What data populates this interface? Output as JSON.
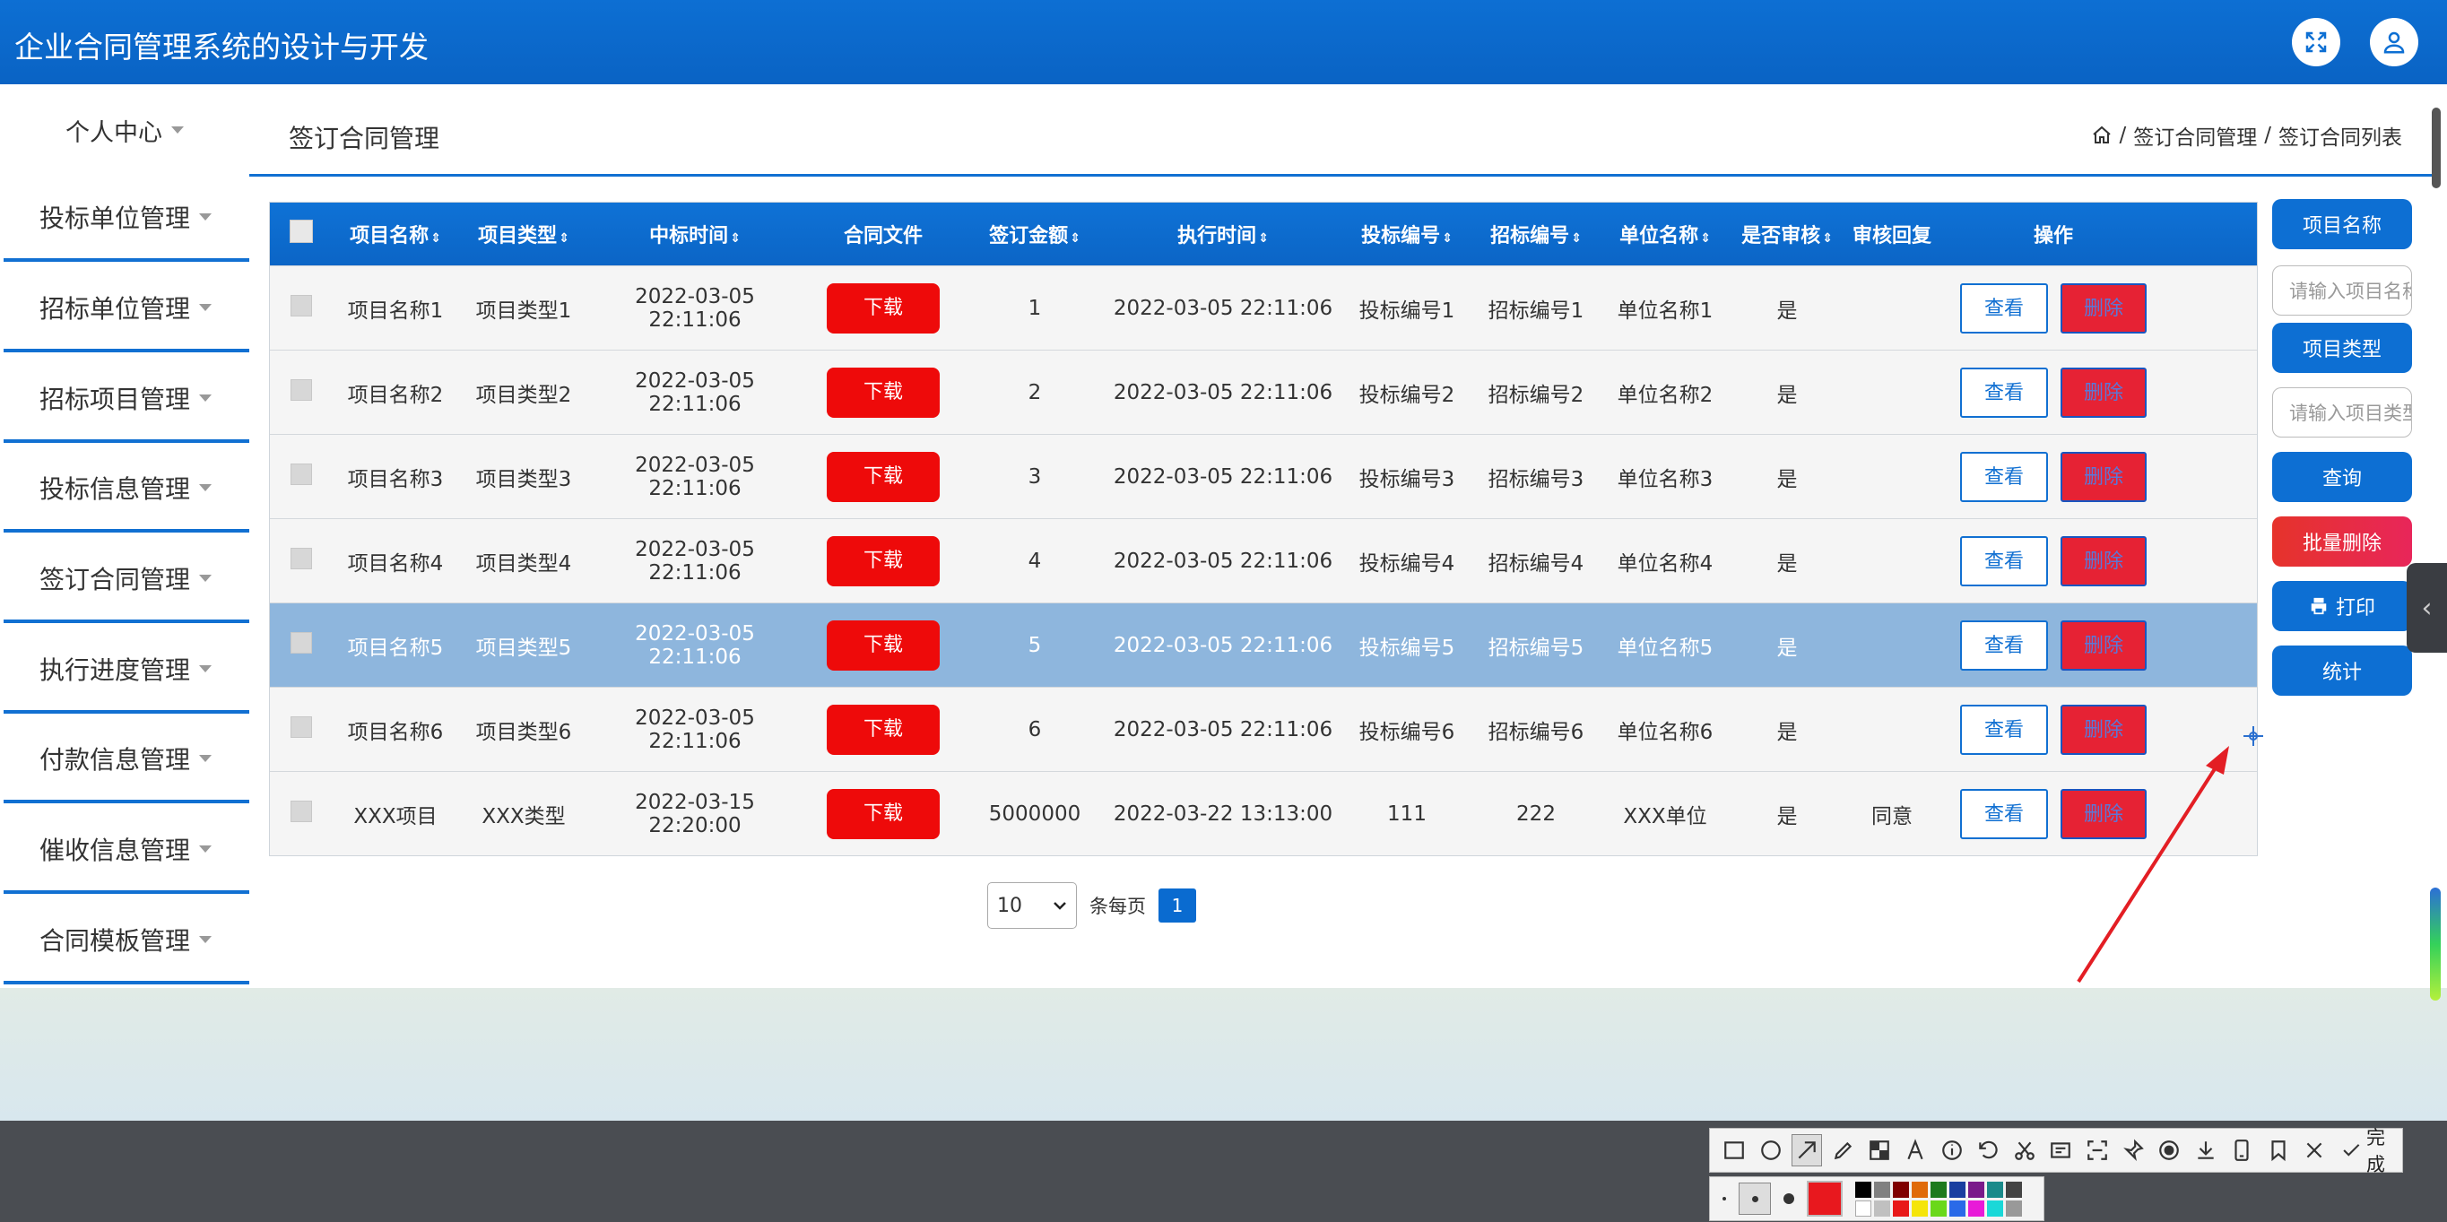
{
  "app": {
    "title": "企业合同管理系统的设计与开发"
  },
  "header": {
    "fullscreen_icon": "expand-icon",
    "user_icon": "user-icon"
  },
  "sidebar": {
    "personal": "个人中心",
    "items": [
      {
        "label": "投标单位管理"
      },
      {
        "label": "招标单位管理"
      },
      {
        "label": "招标项目管理"
      },
      {
        "label": "投标信息管理"
      },
      {
        "label": "签订合同管理"
      },
      {
        "label": "执行进度管理"
      },
      {
        "label": "付款信息管理"
      },
      {
        "label": "催收信息管理"
      },
      {
        "label": "合同模板管理"
      }
    ]
  },
  "page": {
    "title": "签订合同管理",
    "breadcrumb": {
      "sep": "/",
      "level1": "签订合同管理",
      "level2": "签订合同列表"
    }
  },
  "table": {
    "columns": [
      "项目名称",
      "项目类型",
      "中标时间",
      "合同文件",
      "签订金额",
      "执行时间",
      "投标编号",
      "招标编号",
      "单位名称",
      "是否审核",
      "审核回复",
      "操作"
    ],
    "sort_mark": "⇕",
    "download_label": "下载",
    "view_label": "查看",
    "delete_label": "删除",
    "rows": [
      {
        "name": "项目名称1",
        "type": "项目类型1",
        "bid_time": "2022-03-05 22:11:06",
        "amount": "1",
        "exec_time": "2022-03-05 22:11:06",
        "bid_no": "投标编号1",
        "tender_no": "招标编号1",
        "unit": "单位名称1",
        "audited": "是",
        "reply": ""
      },
      {
        "name": "项目名称2",
        "type": "项目类型2",
        "bid_time": "2022-03-05 22:11:06",
        "amount": "2",
        "exec_time": "2022-03-05 22:11:06",
        "bid_no": "投标编号2",
        "tender_no": "招标编号2",
        "unit": "单位名称2",
        "audited": "是",
        "reply": ""
      },
      {
        "name": "项目名称3",
        "type": "项目类型3",
        "bid_time": "2022-03-05 22:11:06",
        "amount": "3",
        "exec_time": "2022-03-05 22:11:06",
        "bid_no": "投标编号3",
        "tender_no": "招标编号3",
        "unit": "单位名称3",
        "audited": "是",
        "reply": ""
      },
      {
        "name": "项目名称4",
        "type": "项目类型4",
        "bid_time": "2022-03-05 22:11:06",
        "amount": "4",
        "exec_time": "2022-03-05 22:11:06",
        "bid_no": "投标编号4",
        "tender_no": "招标编号4",
        "unit": "单位名称4",
        "audited": "是",
        "reply": ""
      },
      {
        "name": "项目名称5",
        "type": "项目类型5",
        "bid_time": "2022-03-05 22:11:06",
        "amount": "5",
        "exec_time": "2022-03-05 22:11:06",
        "bid_no": "投标编号5",
        "tender_no": "招标编号5",
        "unit": "单位名称5",
        "audited": "是",
        "reply": ""
      },
      {
        "name": "项目名称6",
        "type": "项目类型6",
        "bid_time": "2022-03-05 22:11:06",
        "amount": "6",
        "exec_time": "2022-03-05 22:11:06",
        "bid_no": "投标编号6",
        "tender_no": "招标编号6",
        "unit": "单位名称6",
        "audited": "是",
        "reply": ""
      },
      {
        "name": "XXX项目",
        "type": "XXX类型",
        "bid_time": "2022-03-15 22:20:00",
        "amount": "5000000",
        "exec_time": "2022-03-22 13:13:00",
        "bid_no": "111",
        "tender_no": "222",
        "unit": "XXX单位",
        "audited": "是",
        "reply": "同意"
      }
    ]
  },
  "pager": {
    "page_size": "10",
    "per_page_label": "条每页",
    "current_page": "1"
  },
  "search": {
    "name_label": "项目名称",
    "name_placeholder": "请输入项目名称",
    "type_label": "项目类型",
    "type_placeholder": "请输入项目类型",
    "query_label": "查询",
    "batch_delete_label": "批量删除",
    "print_label": "打印",
    "stats_label": "统计"
  },
  "screenshot_tool": {
    "done_label": "完成"
  },
  "colors": {
    "primary": "#0d6fd3",
    "danger": "#ee0a0a",
    "selected_row": "#8eb6dd"
  }
}
